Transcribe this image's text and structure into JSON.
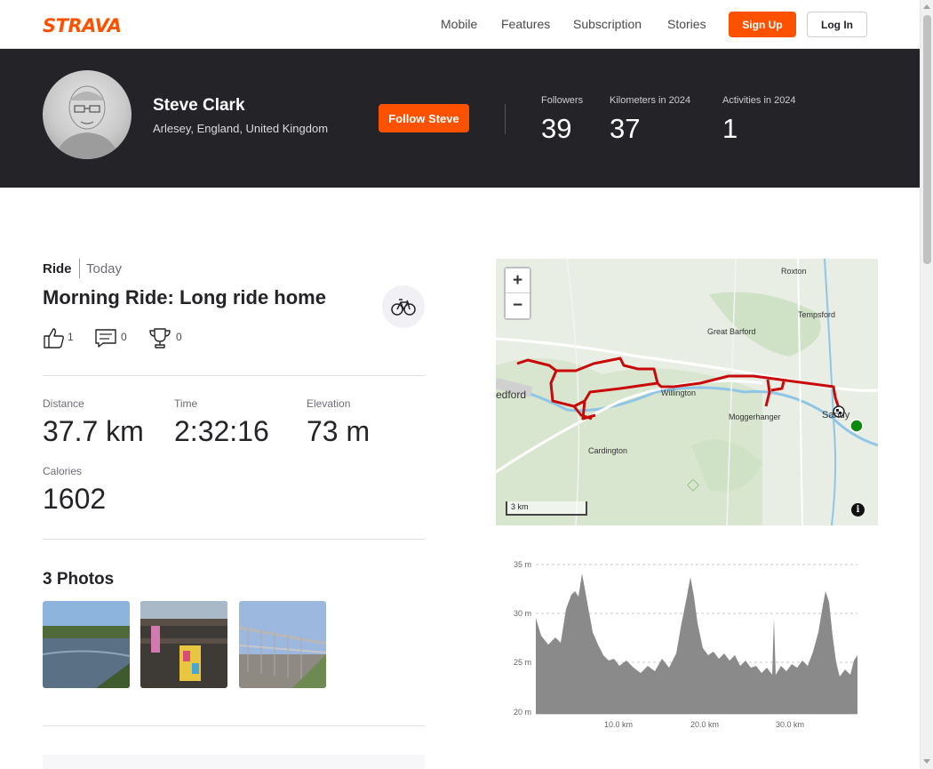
{
  "nav": {
    "logo": "STRAVA",
    "links": [
      "Mobile",
      "Features",
      "Subscription",
      "Stories"
    ],
    "signup": "Sign Up",
    "login": "Log In"
  },
  "athlete": {
    "name": "Steve Clark",
    "location": "Arlesey, England, United Kingdom",
    "follow": "Follow Steve",
    "stats": [
      {
        "label": "Followers",
        "value": "39"
      },
      {
        "label": "Kilometers in 2024",
        "value": "37"
      },
      {
        "label": "Activities in 2024",
        "value": "1"
      }
    ]
  },
  "activity": {
    "type": "Ride",
    "date": "Today",
    "title": "Morning Ride: Long ride home",
    "sport_icon": "bike-icon",
    "kudos": "1",
    "comments": "0",
    "achievements": "0",
    "metrics": {
      "distance": {
        "label": "Distance",
        "value": "37.7 km"
      },
      "time": {
        "label": "Time",
        "value": "2:32:16"
      },
      "elevation": {
        "label": "Elevation",
        "value": "73 m"
      },
      "calories": {
        "label": "Calories",
        "value": "1602"
      }
    },
    "photos_title": "3 Photos"
  },
  "map": {
    "labels": [
      "Roxton",
      "Tempsford",
      "Great Barford",
      "edford",
      "Willington",
      "Moggerhanger",
      "Sandy",
      "Cardington"
    ],
    "zoom_in": "+",
    "zoom_out": "−",
    "scale": "3 km",
    "info": "i",
    "route_color": "#c80a0a"
  },
  "elevation": {
    "y_ticks": [
      "35 m",
      "30 m",
      "25 m",
      "20 m"
    ],
    "x_ticks": [
      "10.0 km",
      "20.0 km",
      "30.0 km"
    ]
  }
}
